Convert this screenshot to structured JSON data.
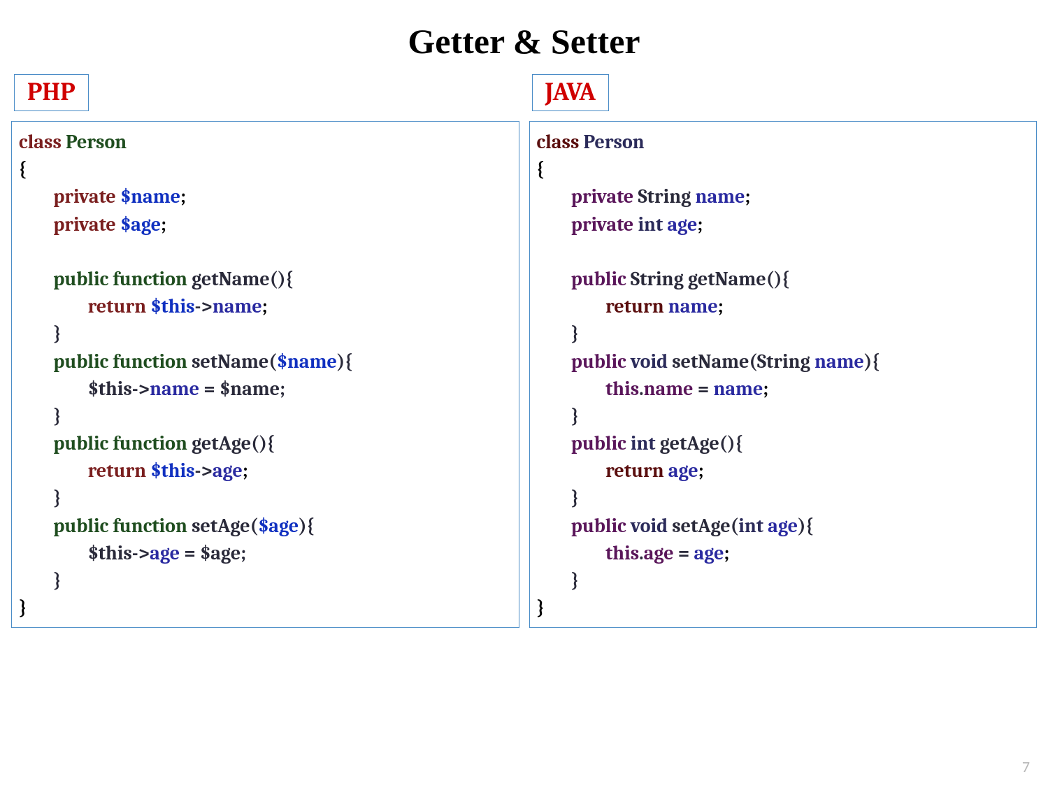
{
  "title": "Getter & Setter",
  "page_number": "7",
  "left": {
    "label": "PHP",
    "code": [
      [
        [
          "t-kw",
          "class "
        ],
        [
          "t-cls",
          "Person"
        ]
      ],
      [
        [
          "t-plain",
          "{"
        ]
      ],
      [
        [
          "t-plain",
          "        "
        ],
        [
          "t-kw",
          "private "
        ],
        [
          "t-var",
          "$name"
        ],
        [
          "t-plain",
          ";"
        ]
      ],
      [
        [
          "t-plain",
          "        "
        ],
        [
          "t-kw",
          "private "
        ],
        [
          "t-var",
          "$age"
        ],
        [
          "t-plain",
          ";"
        ]
      ],
      [
        [
          "t-plain",
          ""
        ]
      ],
      [
        [
          "t-plain",
          "        "
        ],
        [
          "t-cls",
          "public function "
        ],
        [
          "t-dark",
          "getName(){"
        ]
      ],
      [
        [
          "t-plain",
          "                "
        ],
        [
          "t-kw",
          "return "
        ],
        [
          "t-var",
          "$this"
        ],
        [
          "t-dark",
          "->"
        ],
        [
          "t-name",
          "name"
        ],
        [
          "t-plain",
          ";"
        ]
      ],
      [
        [
          "t-plain",
          "        "
        ],
        [
          "t-dark",
          "}"
        ]
      ],
      [
        [
          "t-plain",
          "        "
        ],
        [
          "t-cls",
          "public function "
        ],
        [
          "t-dark",
          "setName("
        ],
        [
          "t-var",
          "$name"
        ],
        [
          "t-dark",
          "){"
        ]
      ],
      [
        [
          "t-plain",
          "                "
        ],
        [
          "t-dark",
          "$this->"
        ],
        [
          "t-name",
          "name"
        ],
        [
          "t-dark",
          " = "
        ],
        [
          "t-dark",
          "$name;"
        ]
      ],
      [
        [
          "t-plain",
          "        "
        ],
        [
          "t-dark",
          "}"
        ]
      ],
      [
        [
          "t-plain",
          "        "
        ],
        [
          "t-cls",
          "public function "
        ],
        [
          "t-dark",
          "getAge(){"
        ]
      ],
      [
        [
          "t-plain",
          "                "
        ],
        [
          "t-kw",
          "return "
        ],
        [
          "t-var",
          "$this"
        ],
        [
          "t-dark",
          "->"
        ],
        [
          "t-name",
          "age"
        ],
        [
          "t-plain",
          ";"
        ]
      ],
      [
        [
          "t-plain",
          "        "
        ],
        [
          "t-dark",
          "}"
        ]
      ],
      [
        [
          "t-plain",
          "        "
        ],
        [
          "t-cls",
          "public function "
        ],
        [
          "t-dark",
          "setAge("
        ],
        [
          "t-var",
          "$age"
        ],
        [
          "t-dark",
          "){"
        ]
      ],
      [
        [
          "t-plain",
          "                "
        ],
        [
          "t-dark",
          "$this->"
        ],
        [
          "t-name",
          "age"
        ],
        [
          "t-dark",
          " = "
        ],
        [
          "t-dark",
          "$age;"
        ]
      ],
      [
        [
          "t-plain",
          "        "
        ],
        [
          "t-dark",
          "}"
        ]
      ],
      [
        [
          "t-plain",
          "}"
        ]
      ]
    ]
  },
  "right": {
    "label": "JAVA",
    "code": [
      [
        [
          "t-kw-b",
          "class "
        ],
        [
          "t-class2",
          "Person"
        ]
      ],
      [
        [
          "t-plain",
          "{"
        ]
      ],
      [
        [
          "t-plain",
          "        "
        ],
        [
          "t-purple",
          "private "
        ],
        [
          "t-dark",
          "String "
        ],
        [
          "t-name",
          "name"
        ],
        [
          "t-plain",
          ";"
        ]
      ],
      [
        [
          "t-plain",
          "        "
        ],
        [
          "t-purple",
          "private "
        ],
        [
          "t-int",
          "int "
        ],
        [
          "t-name",
          "age"
        ],
        [
          "t-plain",
          ";"
        ]
      ],
      [
        [
          "t-plain",
          ""
        ]
      ],
      [
        [
          "t-plain",
          "        "
        ],
        [
          "t-purple",
          "public "
        ],
        [
          "t-dark",
          "String getName(){"
        ]
      ],
      [
        [
          "t-plain",
          "                "
        ],
        [
          "t-kw-b",
          "return "
        ],
        [
          "t-name",
          "name"
        ],
        [
          "t-plain",
          ";"
        ]
      ],
      [
        [
          "t-plain",
          "        "
        ],
        [
          "t-dark",
          "}"
        ]
      ],
      [
        [
          "t-plain",
          "        "
        ],
        [
          "t-purple",
          "public "
        ],
        [
          "t-int",
          "void "
        ],
        [
          "t-dark",
          "setName(String "
        ],
        [
          "t-name",
          "name"
        ],
        [
          "t-dark",
          "){"
        ]
      ],
      [
        [
          "t-plain",
          "                "
        ],
        [
          "t-purple",
          "this"
        ],
        [
          "t-dark",
          "."
        ],
        [
          "t-purple",
          "name"
        ],
        [
          "t-dark",
          " = "
        ],
        [
          "t-name",
          "name"
        ],
        [
          "t-plain",
          ";"
        ]
      ],
      [
        [
          "t-plain",
          "        "
        ],
        [
          "t-dark",
          "}"
        ]
      ],
      [
        [
          "t-plain",
          "        "
        ],
        [
          "t-purple",
          "public "
        ],
        [
          "t-int",
          "int "
        ],
        [
          "t-dark",
          "getAge(){"
        ]
      ],
      [
        [
          "t-plain",
          "                "
        ],
        [
          "t-kw-b",
          "return "
        ],
        [
          "t-name",
          "age"
        ],
        [
          "t-plain",
          ";"
        ]
      ],
      [
        [
          "t-plain",
          "        "
        ],
        [
          "t-dark",
          "}"
        ]
      ],
      [
        [
          "t-plain",
          "        "
        ],
        [
          "t-purple",
          "public "
        ],
        [
          "t-int",
          "void "
        ],
        [
          "t-dark",
          "setAge("
        ],
        [
          "t-int",
          "int "
        ],
        [
          "t-name",
          "age"
        ],
        [
          "t-dark",
          "){"
        ]
      ],
      [
        [
          "t-plain",
          "                "
        ],
        [
          "t-purple",
          "this"
        ],
        [
          "t-dark",
          "."
        ],
        [
          "t-purple",
          "age"
        ],
        [
          "t-dark",
          " = "
        ],
        [
          "t-name",
          "age"
        ],
        [
          "t-plain",
          ";"
        ]
      ],
      [
        [
          "t-plain",
          "        "
        ],
        [
          "t-dark",
          "}"
        ]
      ],
      [
        [
          "t-plain",
          "}"
        ]
      ]
    ]
  }
}
